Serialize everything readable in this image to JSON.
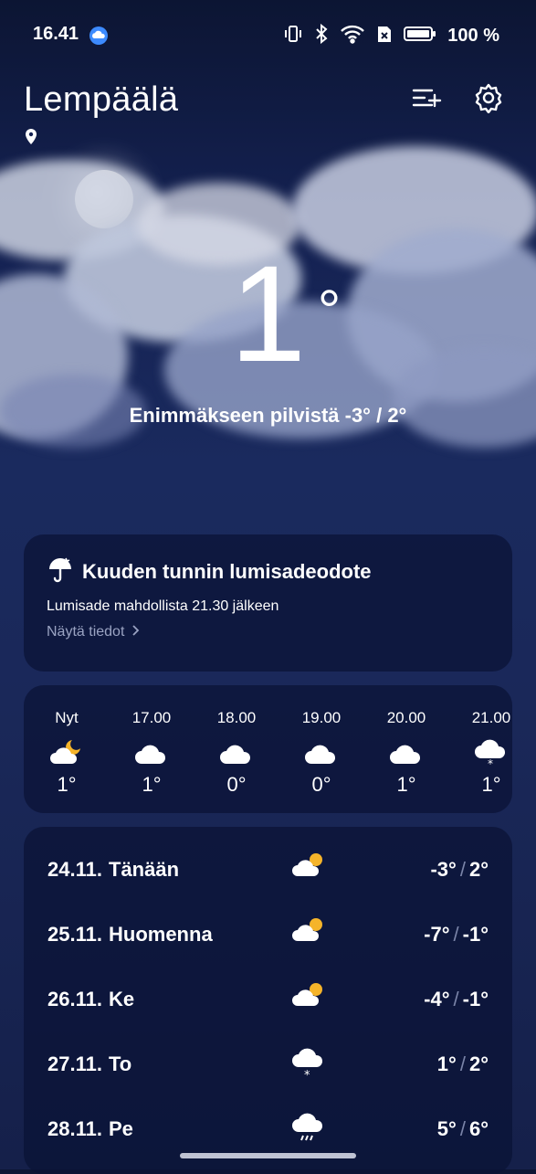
{
  "status": {
    "time": "16.41",
    "battery": "100 %",
    "icons": [
      "cloud-icon",
      "vibrate-icon",
      "bluetooth-icon",
      "wifi-icon",
      "sim-off-icon",
      "battery-icon"
    ]
  },
  "header": {
    "city": "Lempäälä",
    "icons": [
      "location-pin-icon",
      "add-city-icon",
      "gear-icon"
    ]
  },
  "current": {
    "temperature": "1",
    "degree": "°",
    "condition": "Enimmäkseen pilvistä  -3° / 2°"
  },
  "alert": {
    "title": "Kuuden tunnin lumisadeodote",
    "body": "Lumisade mahdollista 21.30 jälkeen",
    "link": "Näytä tiedot",
    "icon": "umbrella-snow-icon"
  },
  "hourly": [
    {
      "time": "Nyt",
      "icon": "partly-cloudy-night-icon",
      "temp": "1°"
    },
    {
      "time": "17.00",
      "icon": "cloud-icon",
      "temp": "1°"
    },
    {
      "time": "18.00",
      "icon": "cloud-icon",
      "temp": "0°"
    },
    {
      "time": "19.00",
      "icon": "cloud-icon",
      "temp": "0°"
    },
    {
      "time": "20.00",
      "icon": "cloud-icon",
      "temp": "1°"
    },
    {
      "time": "21.00",
      "icon": "snow-cloud-icon",
      "temp": "1°"
    }
  ],
  "daily": [
    {
      "date": "24.11.",
      "day": "Tänään",
      "icon": "partly-cloudy-day-icon",
      "low": "-3°",
      "high": "2°"
    },
    {
      "date": "25.11.",
      "day": "Huomenna",
      "icon": "partly-cloudy-day-icon",
      "low": "-7°",
      "high": "-1°"
    },
    {
      "date": "26.11.",
      "day": "Ke",
      "icon": "partly-cloudy-day-icon",
      "low": "-4°",
      "high": "-1°"
    },
    {
      "date": "27.11.",
      "day": "To",
      "icon": "snow-cloud-icon",
      "low": "1°",
      "high": "2°"
    },
    {
      "date": "28.11.",
      "day": "Pe",
      "icon": "rain-cloud-icon",
      "low": "5°",
      "high": "6°"
    }
  ],
  "colors": {
    "background_top": "#0c1533",
    "background_bottom": "#15204a",
    "card": "#0a1234",
    "sun": "#f5b42a",
    "muted": "#9aa3c2"
  }
}
